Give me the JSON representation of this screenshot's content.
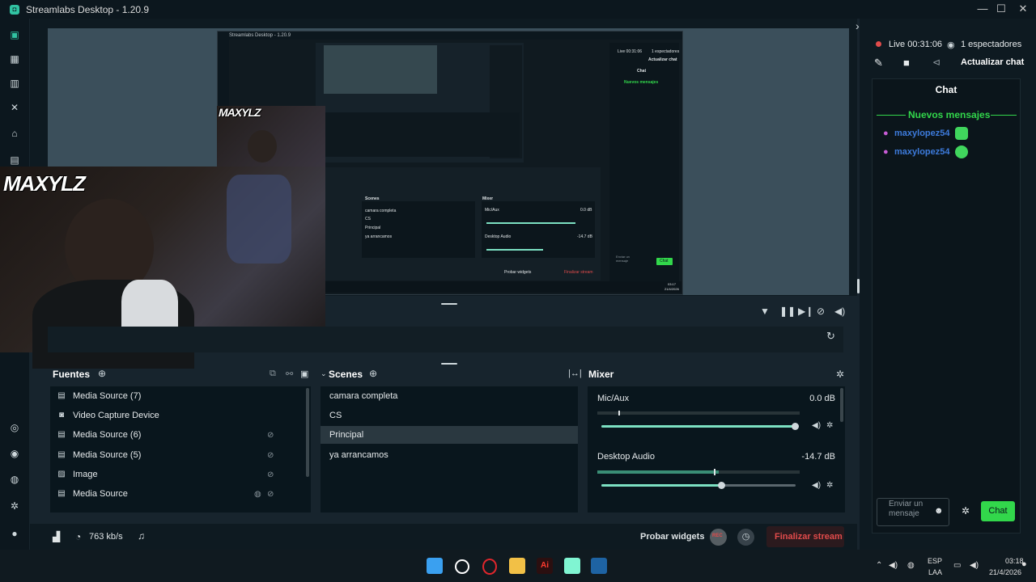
{
  "window": {
    "title": "Streamlabs Desktop - 1.20.9",
    "controls": [
      "—",
      "☐",
      "✕"
    ]
  },
  "nav": {
    "icons": [
      "editor-icon",
      "layout-icon",
      "library-icon",
      "tools-icon",
      "store-icon",
      "highlighter-icon",
      "theme-icon",
      "apps-icon",
      "cloud-icon",
      "settings-icon",
      "user-icon"
    ]
  },
  "nested_preview": {
    "title": "Streamlabs Desktop - 1.20.9",
    "scenes_title": "Scenes",
    "scenes": [
      "camara completa",
      "CS",
      "Principal",
      "ya arrancamos"
    ],
    "mixer_title": "Mixer",
    "mixer": [
      {
        "name": "Mic/Aux",
        "db": "0.0 dB"
      },
      {
        "name": "Desktop Audio",
        "db": "-14.7 dB"
      }
    ],
    "chat_title": "Chat",
    "new_messages": "Nuevos mensajes",
    "live": "Live 00:31:06",
    "viewers": "1 espectadores",
    "refresh": "Actualizar chat",
    "send_placeholder": "Enviar un mensaje",
    "chat_button": "Chat",
    "probar": "Probar widgets",
    "finalizar": "Finalizar stream",
    "clock": "03:17",
    "date": "21/4/2026"
  },
  "sources": {
    "title": "Fuentes",
    "items": [
      {
        "label": "Media Source (7)",
        "icon": "media-icon"
      },
      {
        "label": "Video Capture Device",
        "icon": "camera-icon"
      },
      {
        "label": "Media Source (6)",
        "icon": "media-icon"
      },
      {
        "label": "Media Source (5)",
        "icon": "media-icon"
      },
      {
        "label": "Image",
        "icon": "image-icon"
      },
      {
        "label": "Media Source",
        "icon": "media-icon"
      }
    ]
  },
  "scenes": {
    "title": "Scenes",
    "items": [
      "camara completa",
      "CS",
      "Principal",
      "ya arrancamos"
    ],
    "active_index": 2
  },
  "mixer": {
    "title": "Mixer",
    "channels": [
      {
        "name": "Mic/Aux",
        "db": "0.0 dB",
        "meter_level": 0.0,
        "volume": 1.0
      },
      {
        "name": "Desktop Audio",
        "db": "-14.7 dB",
        "meter_level": 0.6,
        "volume": 0.62
      }
    ]
  },
  "footer": {
    "bitrate": "763 kb/s",
    "probar": "Probar widgets",
    "rec": "REC",
    "finalizar": "Finalizar stream"
  },
  "chat": {
    "live": "Live 00:31:06",
    "viewers": "1 espectadores",
    "refresh": "Actualizar chat",
    "title": "Chat",
    "new_messages": "Nuevos mensajes",
    "messages": [
      {
        "user": "maxylopez54",
        "sep": ":"
      },
      {
        "user": "maxylopez54",
        "sep": ":"
      }
    ],
    "placeholder": "Enviar un mensaje",
    "send_button": "Chat"
  },
  "taskbar": {
    "lang_top": "ESP",
    "lang_bottom": "LAA",
    "time": "03:18",
    "date": "21/4/2026"
  },
  "colors": {
    "accent": "#31c3a2",
    "chat_button": "#32d74b",
    "username": "#3d7bdc",
    "finalizar": "#e04b4b",
    "live_dot": "#e04b4b"
  }
}
